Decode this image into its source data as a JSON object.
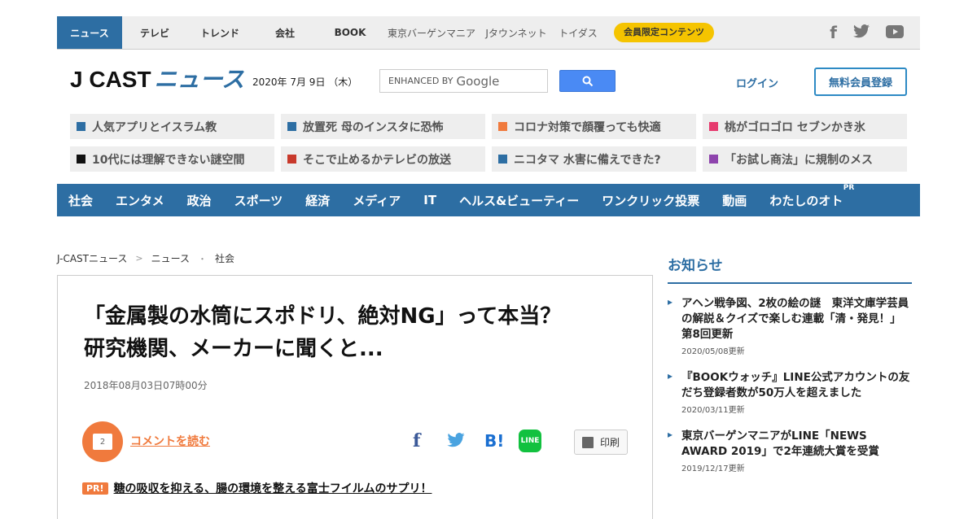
{
  "topbar": {
    "tabs": [
      "ニュース",
      "テレビ",
      "トレンド",
      "会社",
      "BOOK",
      "東京バーゲンマニア",
      "Jタウンネット",
      "トイダス"
    ],
    "member_button": "会員限定コンテンツ",
    "social_icons": [
      "facebook-icon",
      "twitter-icon",
      "youtube-icon"
    ]
  },
  "header": {
    "logo_main": "J CAST",
    "logo_sub": "ニュース",
    "date": "2020年 7月 9日 （木）",
    "search_prefix": "ENHANCED BY",
    "search_brand": "Google",
    "login": "ログイン",
    "register": "無料会員登録"
  },
  "trends": [
    {
      "label": "人気アプリとイスラム教",
      "color": "#2d6ea3"
    },
    {
      "label": "放置死 母のインスタに恐怖",
      "color": "#2d6ea3"
    },
    {
      "label": "コロナ対策で顔覆っても快適",
      "color": "#f07a3d"
    },
    {
      "label": "桃がゴロゴロ セブンかき氷",
      "color": "#e63a6e"
    },
    {
      "label": "10代には理解できない謎空間",
      "color": "#111111"
    },
    {
      "label": "そこで止めるかテレビの放送",
      "color": "#c8392b"
    },
    {
      "label": "ニコタマ 水害に備えできた?",
      "color": "#2d6ea3"
    },
    {
      "label": "「お試し商法」に規制のメス",
      "color": "#8e44ad"
    }
  ],
  "nav": {
    "items": [
      "社会",
      "エンタメ",
      "政治",
      "スポーツ",
      "経済",
      "メディア",
      "IT",
      "ヘルス&ビューティー",
      "ワンクリック投票",
      "動画",
      "わたしのオト"
    ],
    "pr_label": "PR"
  },
  "breadcrumb": {
    "items": [
      "J-CASTニュース",
      "ニュース",
      "社会"
    ],
    "sep1": ">",
    "sep2": "・"
  },
  "article": {
    "title": "「金属製の水筒にスポドリ、絶対NG」って本当？　研究機関、メーカーに聞くと...",
    "date": "2018年08月03日07時00分",
    "comment_count": "2",
    "comment_link": "コメントを読む",
    "share": {
      "facebook": "f",
      "twitter": "🐦",
      "hatena": "B!",
      "line": "LINE"
    },
    "print": "印刷",
    "ad_tag": "PR!",
    "ad_text": "糖の吸収を抑える、腸の環境を整える富士フイルムのサプリ！"
  },
  "notice": {
    "title": "お知らせ",
    "items": [
      {
        "text": "アヘン戦争図、2枚の絵の謎　東洋文庫学芸員の解説＆クイズで楽しむ連載「清・発見！」第8回更新",
        "date": "2020/05/08更新"
      },
      {
        "text": "『BOOKウォッチ』LINE公式アカウントの友だち登録者数が50万人を超えました",
        "date": "2020/03/11更新"
      },
      {
        "text": "東京バーゲンマニアがLINE「NEWS AWARD 2019」で2年連続大賞を受賞",
        "date": "2019/12/17更新"
      }
    ]
  },
  "colors": {
    "brand": "#2d6ea3",
    "accent": "#f07a3d",
    "member": "#f5c400"
  }
}
